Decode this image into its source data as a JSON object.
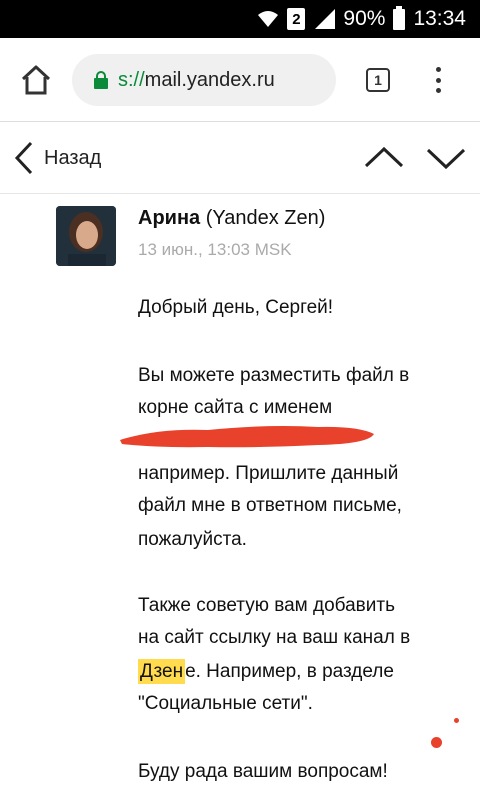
{
  "status_bar": {
    "sim_slot": "2",
    "battery": "90%",
    "time": "13:34"
  },
  "browser": {
    "url_scheme": "s://",
    "url_host": "mail.yandex.ru",
    "tab_count": "1"
  },
  "toolbar": {
    "back_label": "Назад"
  },
  "message": {
    "sender_name": "Арина",
    "sender_org": " (Yandex Zen)",
    "date": "13 июн., 13:03 MSK",
    "lines": {
      "greeting": "Добрый день, Сергей!",
      "p1_l1": "Вы можете разместить файл в",
      "p1_l2": "корне сайта с именем",
      "p1_l3": "например. Пришлите данный",
      "p1_l4": "файл мне в ответном письме,",
      "p1_l5": "пожалуйста.",
      "p2_l1": "Также советую вам добавить",
      "p2_l2": "на сайт ссылку на ваш канал в",
      "p2_l3_highlight": "Дзен",
      "p2_l3_rest": "е. Например, в разделе",
      "p2_l4": "\"Социальные сети\".",
      "closing": "Буду рада вашим вопросам!"
    }
  },
  "colors": {
    "accent_green": "#0a8a3a",
    "highlight_yellow": "#ffdb4d",
    "redaction_red": "#e8412c"
  }
}
